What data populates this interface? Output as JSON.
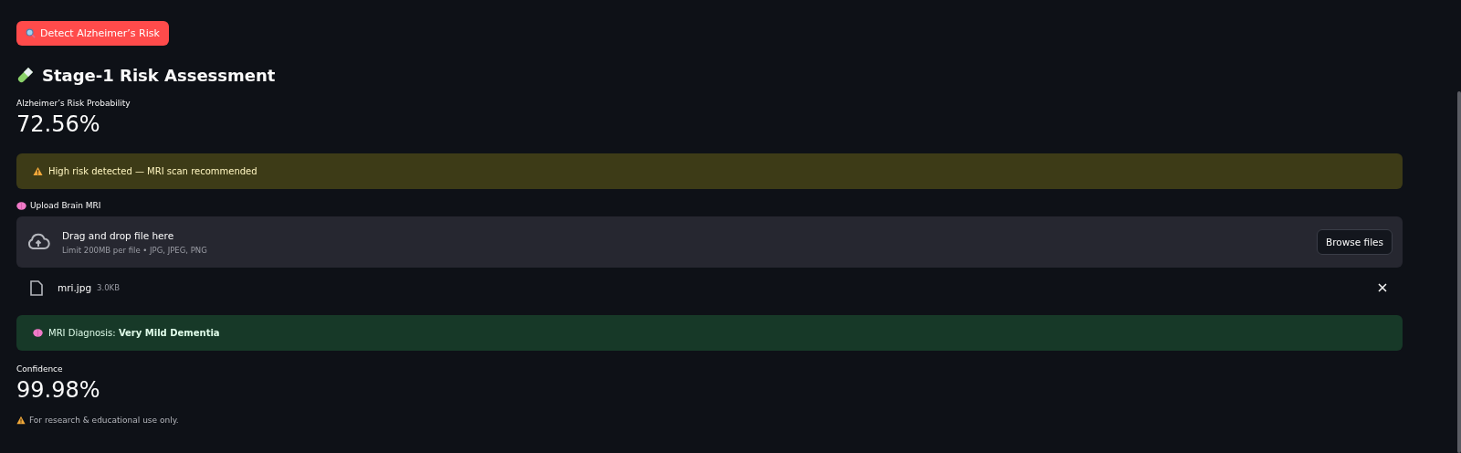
{
  "detect_button": {
    "label": "Detect Alzheimer’s Risk"
  },
  "heading": "Stage-1 Risk Assessment",
  "risk_metric": {
    "label": "Alzheimer’s Risk Probability",
    "value": "72.56%"
  },
  "warning_alert": {
    "text": "High risk detected — MRI scan recommended"
  },
  "uploader": {
    "label": "Upload Brain MRI",
    "title": "Drag and drop file here",
    "hint": "Limit 200MB per file • JPG, JPEG, PNG",
    "button": "Browse files"
  },
  "uploaded_file": {
    "name": "mri.jpg",
    "size": "3.0KB"
  },
  "success_alert": {
    "text": "MRI Diagnosis: **Very Mild Dementia**"
  },
  "confidence_metric": {
    "label": "Confidence",
    "value": "99.98%"
  },
  "footnote": "For research & educational use only."
}
